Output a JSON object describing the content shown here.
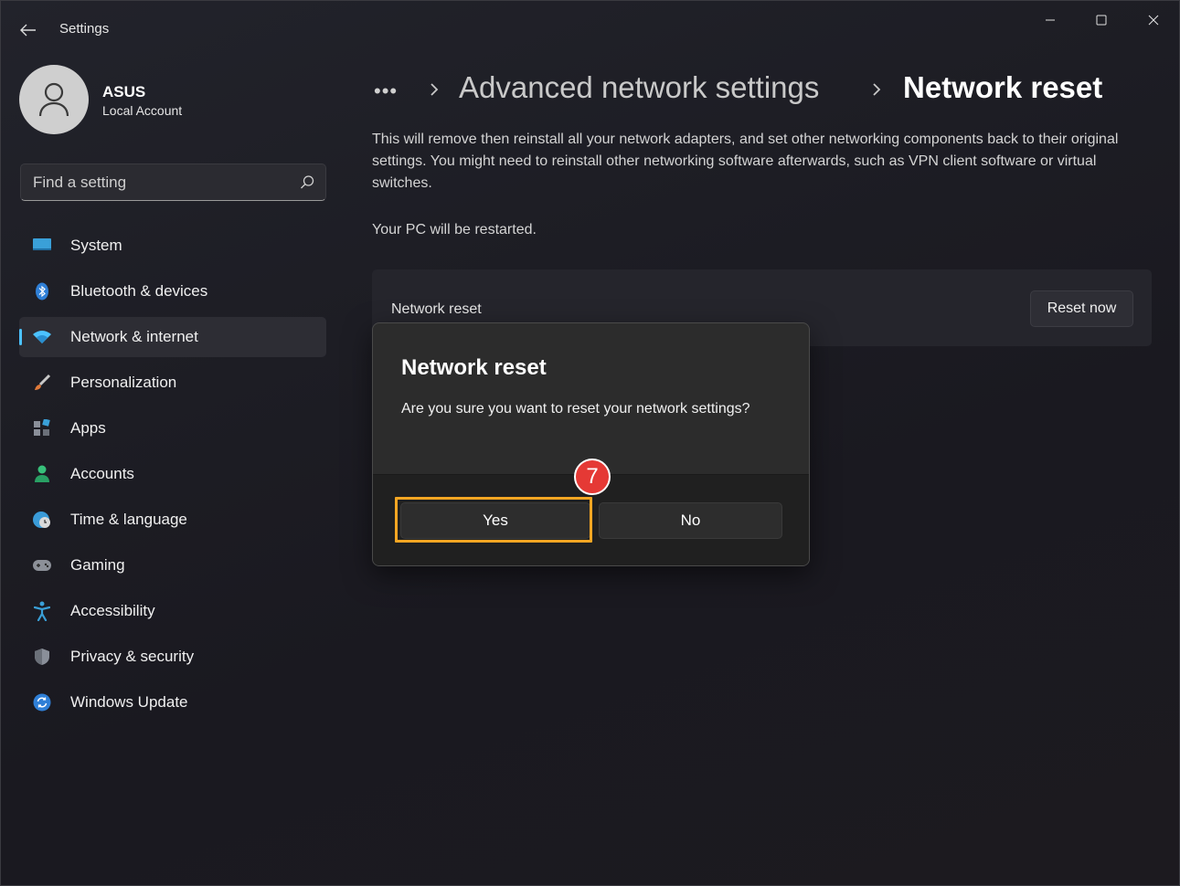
{
  "window": {
    "app_title": "Settings",
    "controls": {
      "minimize": "minimize",
      "maximize": "maximize",
      "close": "close"
    }
  },
  "profile": {
    "name": "ASUS",
    "account_type": "Local Account"
  },
  "search": {
    "placeholder": "Find a setting"
  },
  "sidebar": {
    "items": [
      {
        "label": "System",
        "icon": "monitor-icon",
        "active": false
      },
      {
        "label": "Bluetooth & devices",
        "icon": "bluetooth-icon",
        "active": false
      },
      {
        "label": "Network & internet",
        "icon": "wifi-icon",
        "active": true
      },
      {
        "label": "Personalization",
        "icon": "brush-icon",
        "active": false
      },
      {
        "label": "Apps",
        "icon": "apps-icon",
        "active": false
      },
      {
        "label": "Accounts",
        "icon": "person-icon",
        "active": false
      },
      {
        "label": "Time & language",
        "icon": "globe-clock-icon",
        "active": false
      },
      {
        "label": "Gaming",
        "icon": "gamepad-icon",
        "active": false
      },
      {
        "label": "Accessibility",
        "icon": "accessibility-icon",
        "active": false
      },
      {
        "label": "Privacy & security",
        "icon": "shield-icon",
        "active": false
      },
      {
        "label": "Windows Update",
        "icon": "update-icon",
        "active": false
      }
    ]
  },
  "breadcrumb": {
    "more": "•••",
    "parent": "Advanced network settings",
    "current": "Network reset"
  },
  "main": {
    "description": "This will remove then reinstall all your network adapters, and set other networking components back to their original settings. You might need to reinstall other networking software afterwards, such as VPN client software or virtual switches.",
    "restart_note": "Your PC will be restarted.",
    "card_title": "Network reset",
    "reset_button": "Reset now"
  },
  "dialog": {
    "title": "Network reset",
    "message": "Are you sure you want to reset your network settings?",
    "yes_label": "Yes",
    "no_label": "No"
  },
  "annotation": {
    "step_number": "7",
    "highlight_color": "#f5a623",
    "badge_color": "#e53935"
  },
  "colors": {
    "accent": "#4cc2ff",
    "background": "#1d1d24"
  }
}
